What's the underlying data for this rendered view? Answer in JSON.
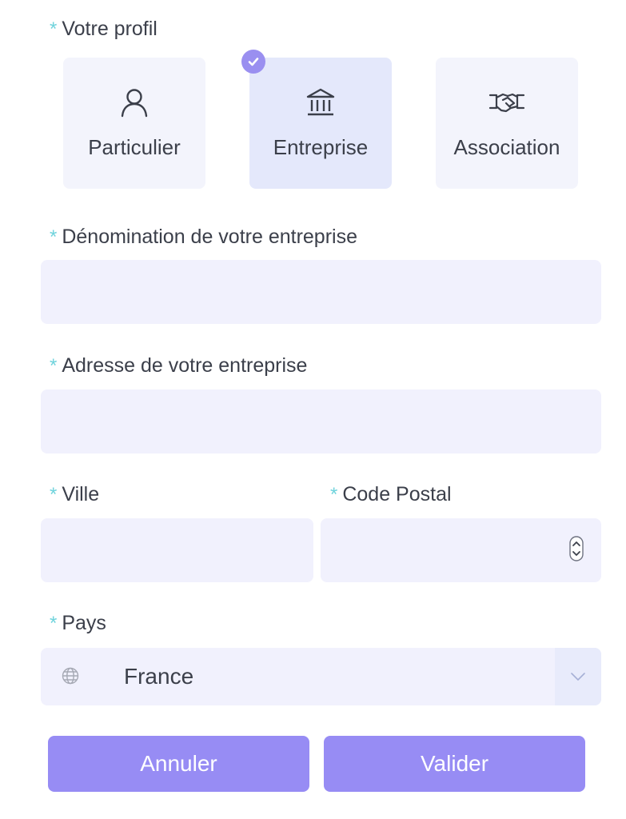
{
  "profile": {
    "label": "Votre profil",
    "required_mark": "*",
    "options": [
      {
        "label": "Particulier",
        "icon": "person-icon",
        "selected": false
      },
      {
        "label": "Entreprise",
        "icon": "bank-building-icon",
        "selected": true
      },
      {
        "label": "Association",
        "icon": "handshake-icon",
        "selected": false
      }
    ]
  },
  "company_name": {
    "label": "Dénomination de votre entreprise",
    "required_mark": "*",
    "value": ""
  },
  "company_address": {
    "label": "Adresse de votre entreprise",
    "required_mark": "*",
    "value": ""
  },
  "city": {
    "label": "Ville",
    "required_mark": "*",
    "value": ""
  },
  "postal_code": {
    "label": "Code Postal",
    "required_mark": "*",
    "value": ""
  },
  "country": {
    "label": "Pays",
    "required_mark": "*",
    "selected": "France",
    "icon": "globe-icon"
  },
  "actions": {
    "cancel_label": "Annuler",
    "submit_label": "Valider"
  },
  "colors": {
    "accent": "#978cf4",
    "required_mark": "#6fd3dc",
    "field_background": "#f1f1fd",
    "selected_card": "#e4e8fb"
  }
}
